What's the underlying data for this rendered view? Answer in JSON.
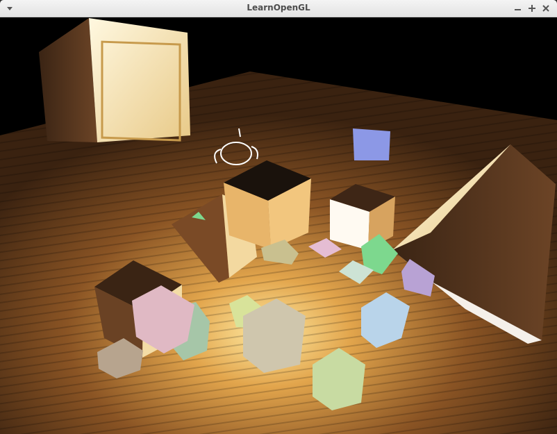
{
  "window": {
    "title": "LearnOpenGL",
    "buttons": [
      "menu",
      "minimize",
      "maximize",
      "close"
    ]
  },
  "scene": {
    "background": "#000000",
    "floor_color": "#6b4420",
    "crate_light": "#f2dc9a",
    "crate_dark": "#5a3a20",
    "light_cubes": [
      "#8c98e6",
      "#7dd88e",
      "#e5bdd3",
      "#b8a2d4",
      "#cde3d5",
      "#b9d4ea",
      "#d8e39a",
      "#cfc6ad",
      "#c8dba2",
      "#b7a48e",
      "#a6c6a8",
      "#c9c08f",
      "#e0b9c4"
    ]
  }
}
